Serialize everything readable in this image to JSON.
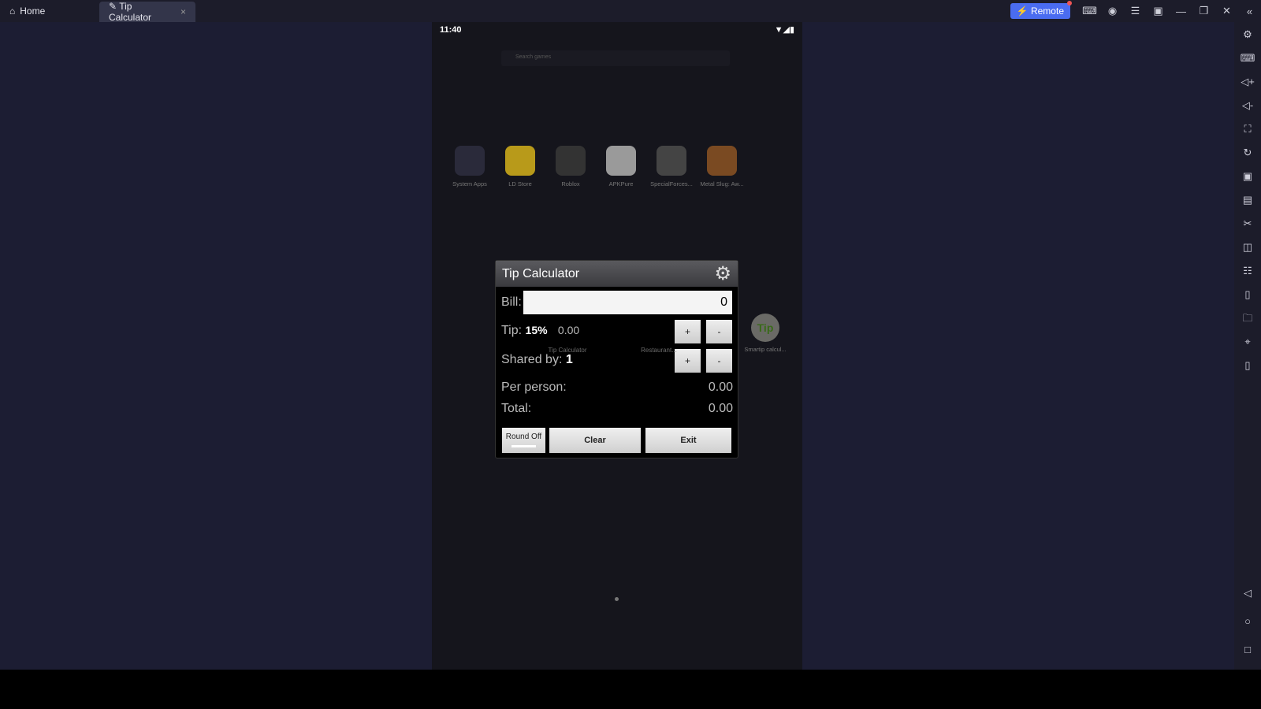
{
  "titlebar": {
    "tabs": [
      {
        "label": "Home",
        "icon": "home-icon"
      },
      {
        "label": "Tip Calculator",
        "icon": "app-icon"
      }
    ],
    "remote_label": "Remote"
  },
  "android": {
    "time": "11:40",
    "search_placeholder": "Search games",
    "apps": [
      "System Apps",
      "LD Store",
      "Roblox",
      "APKPure",
      "SpecialForces...",
      "Metal Slug: Aw..."
    ],
    "background_apps": [
      "Tip Calculator",
      "Restaurant...",
      "Smartip calcul..."
    ],
    "tip_icon_text": "Tip"
  },
  "dialog": {
    "title": "Tip Calculator",
    "bill_label": "Bill:",
    "bill_value": "0",
    "tip_label": "Tip:",
    "tip_percent": "15%",
    "tip_amount": "0.00",
    "shared_label": "Shared by:",
    "shared_count": "1",
    "plus": "+",
    "minus": "-",
    "per_person_label": "Per person:",
    "per_person_value": "0.00",
    "total_label": "Total:",
    "total_value": "0.00",
    "round_off": "Round Off",
    "clear": "Clear",
    "exit": "Exit"
  }
}
